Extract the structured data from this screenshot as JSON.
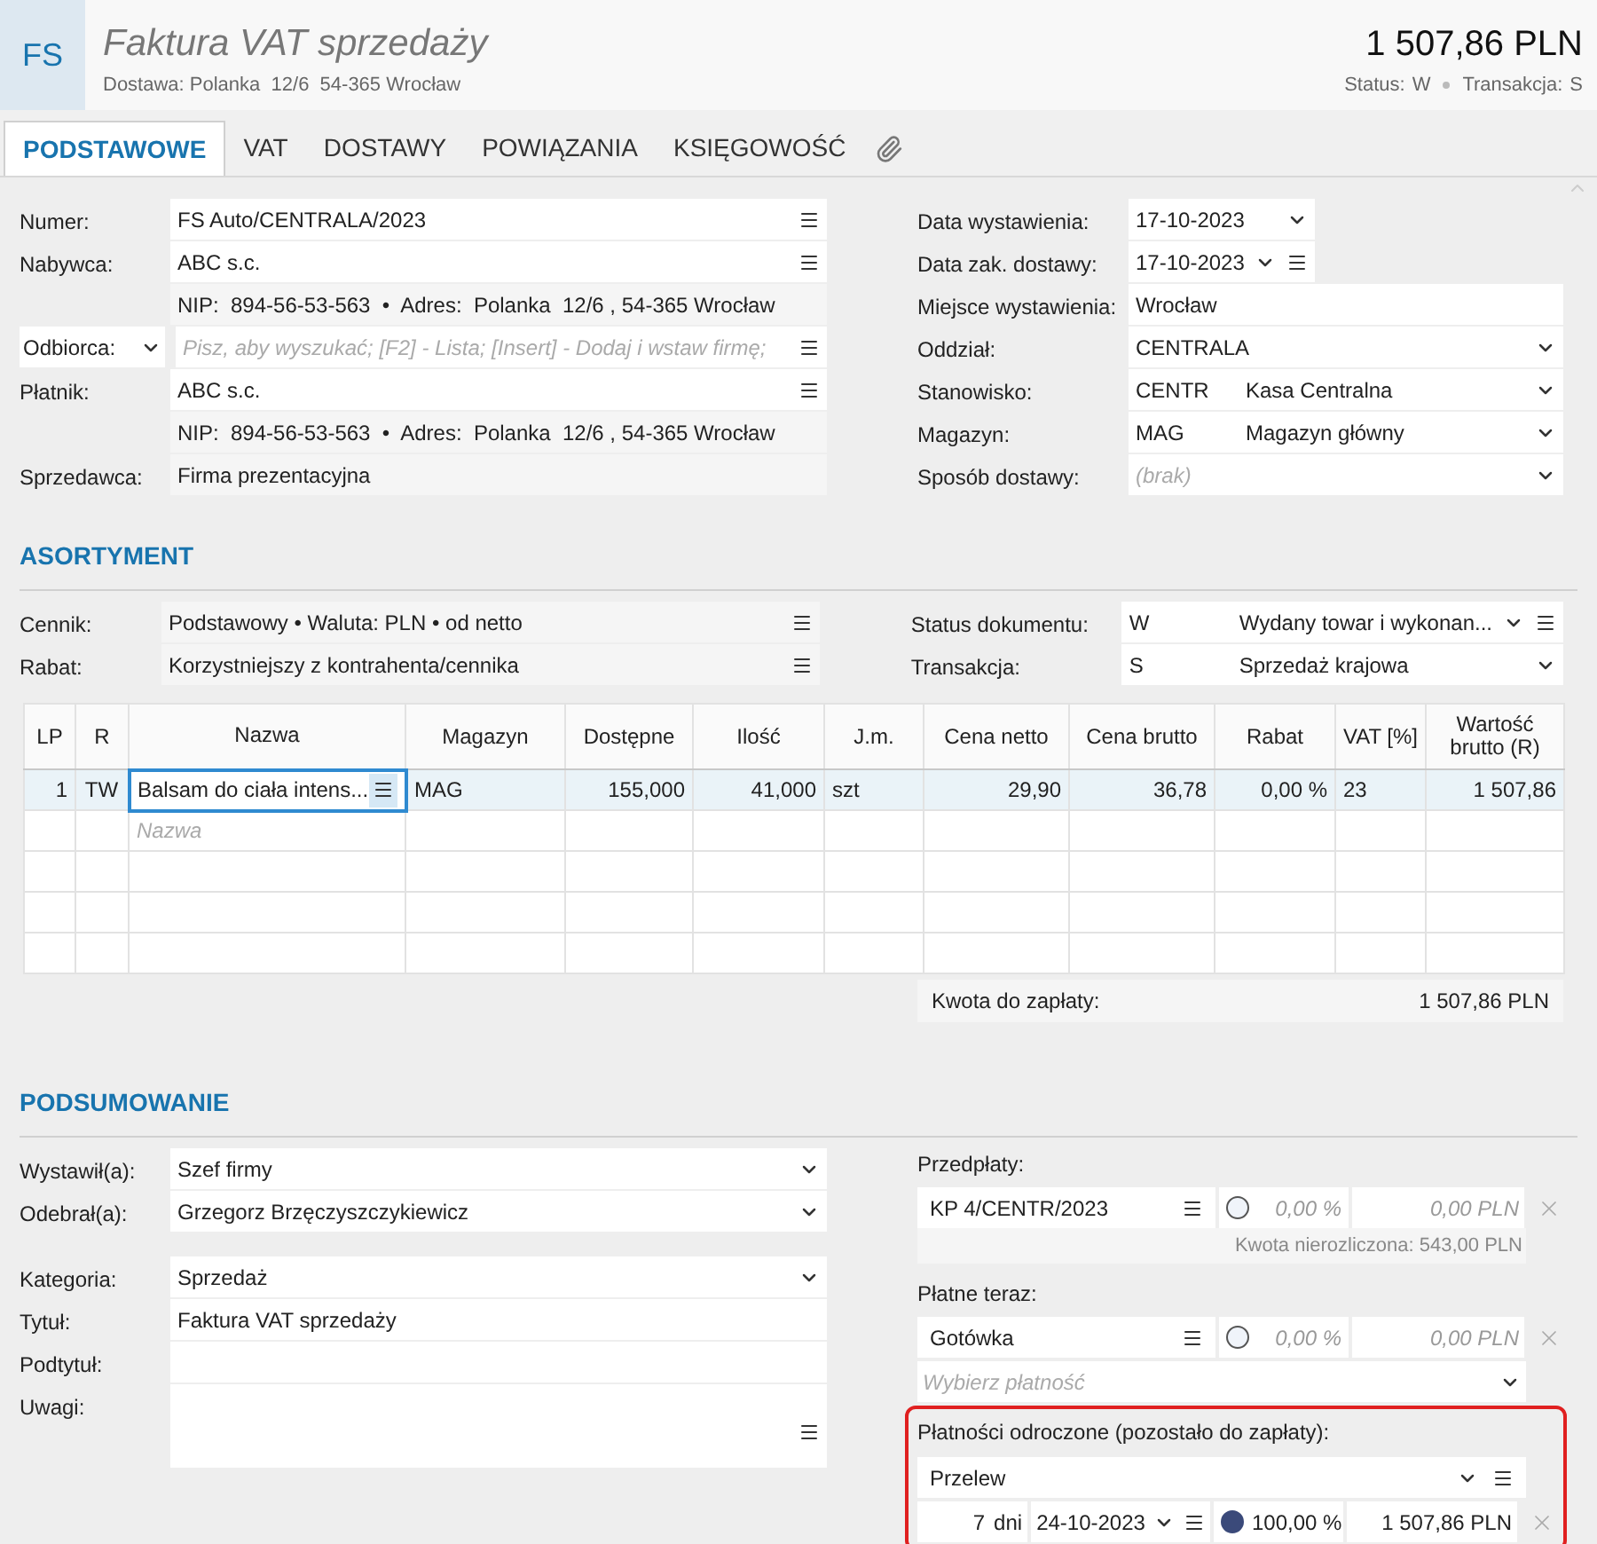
{
  "header": {
    "badge": "FS",
    "title": "Faktura VAT sprzedaży",
    "subtitle": "Dostawa: Polanka  12/6  54-365 Wrocław",
    "amount": "1 507,86 PLN",
    "status_label": "Status:",
    "status": "W",
    "transaction_label": "Transakcja:",
    "transaction": "S"
  },
  "tabs": [
    {
      "label": "PODSTAWOWE",
      "selected": true
    },
    {
      "label": "VAT",
      "selected": false
    },
    {
      "label": "DOSTAWY",
      "selected": false
    },
    {
      "label": "POWIĄZANIA",
      "selected": false
    },
    {
      "label": "KSIĘGOWOŚĆ",
      "selected": false
    }
  ],
  "left_fields": [
    {
      "label": "Numer:",
      "kind": "lookup",
      "value": "FS Auto/CENTRALA/2023"
    },
    {
      "label": "Nabywca:",
      "kind": "lookup",
      "value": "ABC s.c."
    },
    {
      "kind": "info",
      "value": "NIP:  894-56-53-563  •  Adres:  Polanka  12/6 , 54-365 Wrocław"
    },
    {
      "label": "Odbiorca:",
      "label_select": true,
      "kind": "lookup",
      "placeholder": "Pisz, aby wyszukać; [F2] - Lista; [Insert] - Dodaj i wstaw firmę;"
    },
    {
      "label": "Płatnik:",
      "kind": "lookup",
      "value": "ABC s.c."
    },
    {
      "kind": "info",
      "value": "NIP:  894-56-53-563  •  Adres:  Polanka  12/6 , 54-365 Wrocław"
    },
    {
      "label": "Sprzedawca:",
      "kind": "info",
      "value": "Firma prezentacyjna"
    }
  ],
  "right_fields": [
    {
      "label": "Data wystawienia:",
      "kind": "date",
      "value": "17-10-2023"
    },
    {
      "label": "Data zak. dostawy:",
      "kind": "date-lookup",
      "value": "17-10-2023"
    },
    {
      "label": "Miejsce wystawienia:",
      "kind": "text",
      "value": "Wrocław"
    },
    {
      "label": "Oddział:",
      "kind": "select",
      "value": "CENTRALA"
    },
    {
      "label": "Stanowisko:",
      "kind": "code-select",
      "code": "CENTR",
      "value": "Kasa Centralna"
    },
    {
      "label": "Magazyn:",
      "kind": "code-select",
      "code": "MAG",
      "value": "Magazyn główny"
    },
    {
      "label": "Sposób dostawy:",
      "kind": "select",
      "placeholder": "(brak)"
    }
  ],
  "assortment": {
    "heading": "ASORTYMENT",
    "left_fields": [
      {
        "label": "Cennik:",
        "kind": "readonly-lookup",
        "value": "Podstawowy • Waluta: PLN • od netto"
      },
      {
        "label": "Rabat:",
        "kind": "readonly-lookup",
        "value": "Korzystniejszy z kontrahenta/cennika"
      }
    ],
    "right_fields": [
      {
        "label": "Status dokumentu:",
        "kind": "code-select-lookup",
        "code": "W",
        "value": "Wydany towar i wykonan..."
      },
      {
        "label": "Transakcja:",
        "kind": "code-select",
        "code": "S",
        "value": "Sprzedaż krajowa"
      }
    ],
    "table": {
      "columns": [
        "LP",
        "R",
        "Nazwa",
        "Magazyn",
        "Dostępne",
        "Ilość",
        "J.m.",
        "Cena netto",
        "Cena brutto",
        "Rabat",
        "VAT [%]",
        "Wartość brutto (R)"
      ],
      "rows": [
        {
          "selected": true,
          "cells": [
            {
              "text": "1",
              "focused": false
            },
            {
              "text": "TW",
              "focused": false
            },
            {
              "text": "Balsam do ciała intens...",
              "focused": true
            },
            {
              "text": "MAG",
              "focused": false
            },
            {
              "text": "155,000",
              "focused": false
            },
            {
              "text": "41,000",
              "focused": false
            },
            {
              "text": "szt",
              "focused": false
            },
            {
              "text": "29,90",
              "focused": false
            },
            {
              "text": "36,78",
              "focused": false
            },
            {
              "text": "0,00 %",
              "focused": false
            },
            {
              "text": "23",
              "focused": false
            },
            {
              "text": "1 507,86",
              "focused": false
            }
          ]
        }
      ],
      "new_row_placeholder": "Nazwa"
    },
    "total_label": "Kwota do zapłaty:",
    "total": "1 507,86 PLN"
  },
  "summary": {
    "heading": "PODSUMOWANIE",
    "left_fields": [
      {
        "label": "Wystawił(a):",
        "kind": "select",
        "value": "Szef firmy"
      },
      {
        "label": "Odebrał(a):",
        "kind": "select",
        "value": "Grzegorz Brzęczyszczykiewicz"
      },
      {
        "label": "Kategoria:",
        "kind": "select",
        "value": "Sprzedaż"
      },
      {
        "label": "Tytuł:",
        "kind": "text",
        "value": "Faktura VAT sprzedaży"
      },
      {
        "label": "Podtytuł:",
        "kind": "text"
      },
      {
        "label": "Uwagi:",
        "kind": "memo"
      }
    ],
    "prepayments": {
      "label": "Przedpłaty:",
      "rows": [
        {
          "name": "KP 4/CENTR/2023",
          "selected": false,
          "percent": "0,00 %",
          "amount": "0,00 PLN"
        }
      ],
      "note": "Kwota nierozliczona: 543,00 PLN"
    },
    "paid_now": {
      "label": "Płatne teraz:",
      "rows": [
        {
          "name": "Gotówka",
          "selected": false,
          "percent": "0,00 %",
          "amount": "0,00 PLN"
        }
      ],
      "placeholder": "Wybierz płatność"
    },
    "deferred": {
      "label": "Płatności odroczone (pozostało do zapłaty):",
      "highlighted": true,
      "method": "Przelew",
      "rows": [
        {
          "days": "7",
          "days_unit": "dni",
          "date": "24-10-2023",
          "selected": true,
          "percent": "100,00 %",
          "amount": "1 507,86 PLN"
        }
      ]
    }
  }
}
